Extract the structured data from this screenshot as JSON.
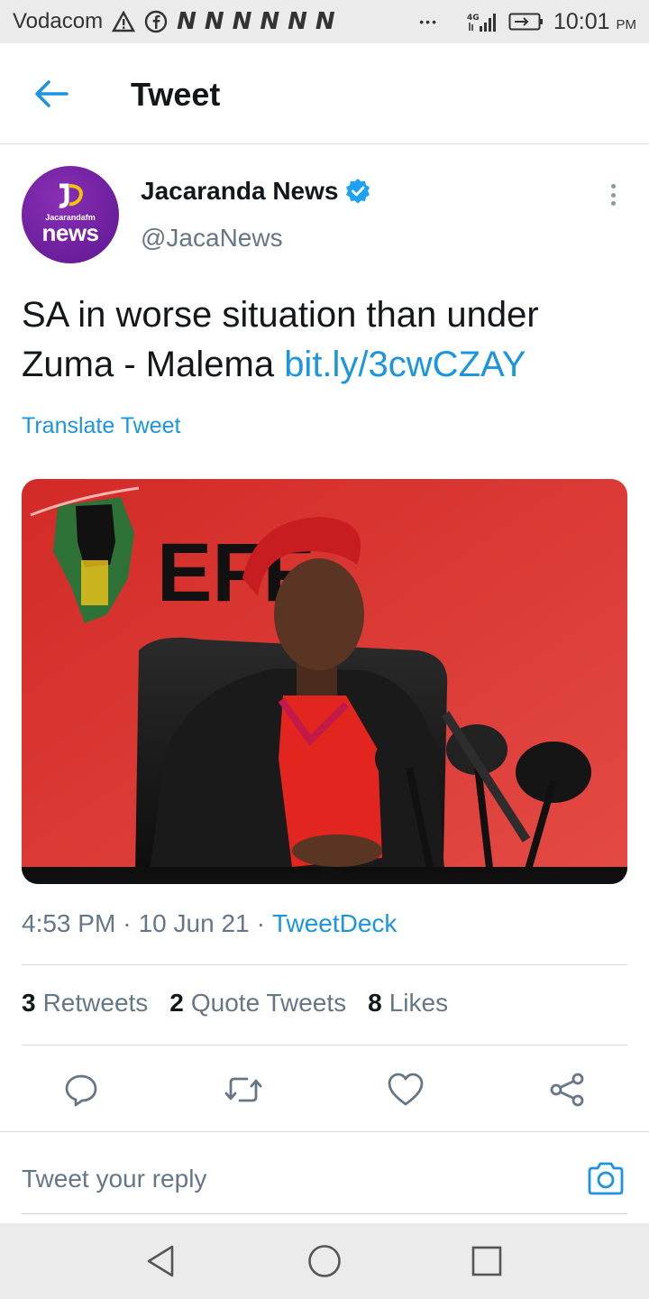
{
  "status_bar": {
    "carrier": "Vodacom",
    "network": "4G",
    "time": "10:01",
    "time_suffix": "PM",
    "notification_icons": [
      "warning-icon",
      "facebook-icon",
      "news24-icon",
      "news24-icon",
      "news24-icon",
      "news24-icon",
      "news24-icon",
      "news24-icon",
      "more-notifications-icon"
    ],
    "n_glyph": "N",
    "overflow_dots": "•••"
  },
  "header": {
    "title": "Tweet",
    "back_icon": "arrow-left-icon"
  },
  "tweet": {
    "author_name": "Jacaranda News",
    "author_handle": "@JacaNews",
    "verified": true,
    "avatar": {
      "brand_small": "Jacarandafm",
      "brand_big": "news"
    },
    "text": "SA in worse situation than under Zuma - Malema",
    "link": "bit.ly/3cwCZAY",
    "translate_label": "Translate Tweet",
    "image_logo_text": "EFF",
    "timestamp": "4:53 PM",
    "date": "10 Jun 21",
    "source": "TweetDeck",
    "separator": "·"
  },
  "stats": {
    "retweets_count": "3",
    "retweets_label": "Retweets",
    "quotes_count": "2",
    "quotes_label": "Quote Tweets",
    "likes_count": "8",
    "likes_label": "Likes"
  },
  "actions": [
    "reply-icon",
    "retweet-icon",
    "like-icon",
    "share-icon"
  ],
  "reply": {
    "placeholder": "Tweet your reply",
    "camera_icon": "camera-icon"
  },
  "nav": [
    "back-triangle-icon",
    "home-circle-icon",
    "recents-square-icon"
  ],
  "colors": {
    "accent": "#1b95e0",
    "text_primary": "#14171a",
    "text_secondary": "#657786",
    "avatar_purple": "#6a1fa0",
    "image_red": "#d8322e",
    "verified": "#1da1f2"
  }
}
